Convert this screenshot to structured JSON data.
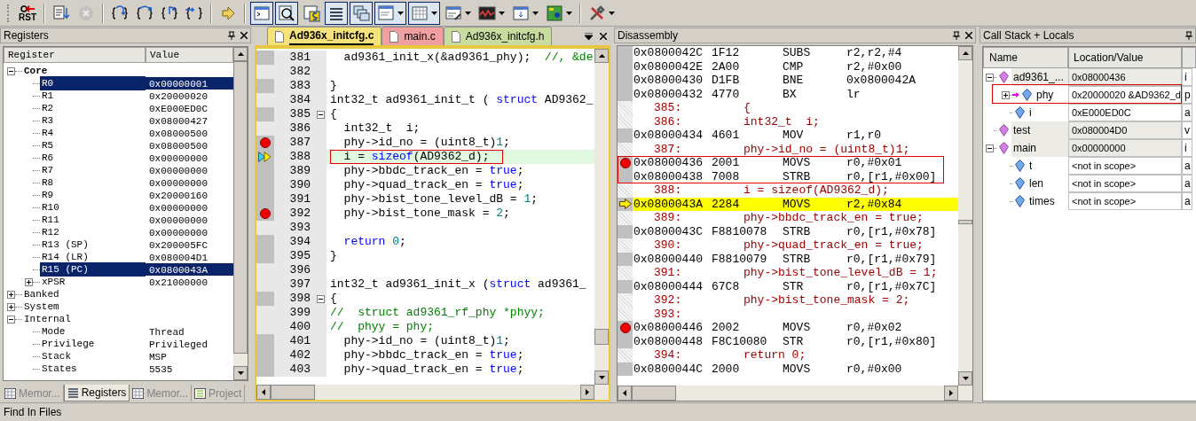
{
  "toolbar": {
    "buttons": [
      {
        "kind": "reset",
        "label": "RST",
        "pressed": false,
        "disabled": false,
        "dropdown": false
      },
      {
        "kind": "run",
        "pressed": false,
        "disabled": false,
        "dropdown": false
      },
      {
        "kind": "stop",
        "pressed": false,
        "disabled": true,
        "dropdown": false
      },
      {
        "kind": "step-into",
        "pressed": false,
        "disabled": false,
        "dropdown": false
      },
      {
        "kind": "step-over",
        "pressed": false,
        "disabled": false,
        "dropdown": false
      },
      {
        "kind": "step-out",
        "pressed": false,
        "disabled": false,
        "dropdown": false
      },
      {
        "kind": "run-to-cursor",
        "pressed": false,
        "disabled": false,
        "dropdown": false
      },
      {
        "kind": "show-next",
        "pressed": false,
        "disabled": false,
        "dropdown": false
      },
      {
        "kind": "command",
        "pressed": true,
        "disabled": false,
        "dropdown": false
      },
      {
        "kind": "disassembly",
        "pressed": true,
        "disabled": false,
        "dropdown": false
      },
      {
        "kind": "symbols",
        "pressed": false,
        "disabled": false,
        "dropdown": false
      },
      {
        "kind": "registers",
        "pressed": true,
        "disabled": false,
        "dropdown": false
      },
      {
        "kind": "call-stack",
        "pressed": true,
        "disabled": false,
        "dropdown": false
      },
      {
        "kind": "watch",
        "pressed": true,
        "disabled": false,
        "dropdown": true
      },
      {
        "kind": "memory",
        "pressed": true,
        "disabled": false,
        "dropdown": true
      },
      {
        "kind": "serial",
        "pressed": false,
        "disabled": false,
        "dropdown": true
      },
      {
        "kind": "analysis",
        "pressed": false,
        "disabled": false,
        "dropdown": true
      },
      {
        "kind": "trace",
        "pressed": false,
        "disabled": false,
        "dropdown": true
      },
      {
        "kind": "system-viewer",
        "pressed": false,
        "disabled": false,
        "dropdown": true
      },
      {
        "kind": "tools",
        "pressed": false,
        "disabled": false,
        "dropdown": true
      }
    ]
  },
  "registers": {
    "title": "Registers",
    "columns": [
      "Register",
      "Value"
    ],
    "tree": [
      {
        "name": "Core",
        "bold": true,
        "expanded": true,
        "selected": false,
        "children": [
          {
            "name": "R0",
            "value": "0x00000001",
            "selected": true
          },
          {
            "name": "R1",
            "value": "0x20000020",
            "selected": false
          },
          {
            "name": "R2",
            "value": "0xE000ED0C",
            "selected": false
          },
          {
            "name": "R3",
            "value": "0x08000427",
            "selected": false
          },
          {
            "name": "R4",
            "value": "0x08000500",
            "selected": false
          },
          {
            "name": "R5",
            "value": "0x08000500",
            "selected": false
          },
          {
            "name": "R6",
            "value": "0x00000000",
            "selected": false
          },
          {
            "name": "R7",
            "value": "0x00000000",
            "selected": false
          },
          {
            "name": "R8",
            "value": "0x00000000",
            "selected": false
          },
          {
            "name": "R9",
            "value": "0x20000160",
            "selected": false
          },
          {
            "name": "R10",
            "value": "0x00000000",
            "selected": false
          },
          {
            "name": "R11",
            "value": "0x00000000",
            "selected": false
          },
          {
            "name": "R12",
            "value": "0x00000000",
            "selected": false
          },
          {
            "name": "R13 (SP)",
            "value": "0x200005FC",
            "selected": false
          },
          {
            "name": "R14 (LR)",
            "value": "0x080004D1",
            "selected": false
          },
          {
            "name": "R15 (PC)",
            "value": "0x0800043A",
            "selected": true
          },
          {
            "name": "xPSR",
            "value": "0x21000000",
            "selected": false,
            "expanded": false
          }
        ]
      },
      {
        "name": "Banked",
        "bold": false,
        "expanded": false,
        "selected": false
      },
      {
        "name": "System",
        "bold": false,
        "expanded": false,
        "selected": false
      },
      {
        "name": "Internal",
        "bold": false,
        "expanded": true,
        "selected": false,
        "children": [
          {
            "name": "Mode",
            "value": "Thread",
            "selected": false
          },
          {
            "name": "Privilege",
            "value": "Privileged",
            "selected": false
          },
          {
            "name": "Stack",
            "value": "MSP",
            "selected": false
          },
          {
            "name": "States",
            "value": "5535",
            "selected": false
          }
        ]
      }
    ],
    "tabs": [
      {
        "label": "Memor...",
        "kind": "memory",
        "selected": false
      },
      {
        "label": "Registers",
        "kind": "registers",
        "selected": true
      },
      {
        "label": "Memor...",
        "kind": "memory",
        "selected": false
      },
      {
        "label": "Project",
        "kind": "project",
        "selected": false
      }
    ]
  },
  "editor": {
    "tabs": [
      {
        "label": "Ad936x_initcfg.c",
        "selected": true,
        "color": "#f5e27a"
      },
      {
        "label": "main.c",
        "selected": false,
        "color": "#f0a0a0"
      },
      {
        "label": "Ad936x_initcfg.h",
        "selected": false,
        "color": "#c8dca0"
      }
    ],
    "lines": [
      {
        "number": "381",
        "executable": true,
        "breakpoint": false,
        "current": false,
        "boxed": false,
        "fold_start": false,
        "tokens": [
          {
            "text": "  ad9361_init_x(&ad9361_phy);  ",
            "kind": "plain"
          },
          {
            "text": "//, &de",
            "kind": "comment"
          }
        ]
      },
      {
        "number": "382",
        "executable": false,
        "breakpoint": false,
        "current": false,
        "fold_start": false
      },
      {
        "number": "383",
        "executable": true,
        "breakpoint": false,
        "current": false,
        "boxed": false,
        "fold_start": false,
        "tokens": [
          {
            "text": "}",
            "kind": "plain"
          }
        ]
      },
      {
        "number": "384",
        "executable": false,
        "breakpoint": false,
        "current": false,
        "boxed": false,
        "fold_start": false,
        "tokens": [
          {
            "text": "int32_t ad9361_init_t ( ",
            "kind": "plain"
          },
          {
            "text": "struct",
            "kind": "keyword"
          },
          {
            "text": " AD9362_",
            "kind": "plain"
          }
        ]
      },
      {
        "number": "385",
        "executable": true,
        "breakpoint": false,
        "current": false,
        "boxed": false,
        "fold_start": true,
        "tokens": [
          {
            "text": "{",
            "kind": "plain"
          }
        ]
      },
      {
        "number": "386",
        "executable": false,
        "breakpoint": false,
        "current": false,
        "boxed": false,
        "fold_start": false,
        "tokens": [
          {
            "text": "  int32_t  i;",
            "kind": "plain"
          }
        ]
      },
      {
        "number": "387",
        "executable": true,
        "breakpoint": true,
        "current": false,
        "boxed": false,
        "fold_start": false,
        "tokens": [
          {
            "text": "  phy->id_no = (uint8_t)",
            "kind": "plain"
          },
          {
            "text": "1",
            "kind": "number"
          },
          {
            "text": ";",
            "kind": "plain"
          }
        ]
      },
      {
        "number": "388",
        "executable": true,
        "breakpoint": false,
        "current": true,
        "boxed": true,
        "fold_start": false,
        "tokens": [
          {
            "text": "  i = ",
            "kind": "plain"
          },
          {
            "text": "sizeof",
            "kind": "keyword"
          },
          {
            "text": "(AD9362_d);",
            "kind": "plain"
          }
        ]
      },
      {
        "number": "389",
        "executable": true,
        "breakpoint": false,
        "current": false,
        "boxed": false,
        "fold_start": false,
        "tokens": [
          {
            "text": "  phy->bbdc_track_en = ",
            "kind": "plain"
          },
          {
            "text": "true",
            "kind": "keyword"
          },
          {
            "text": ";",
            "kind": "plain"
          }
        ]
      },
      {
        "number": "390",
        "executable": true,
        "breakpoint": false,
        "current": false,
        "boxed": false,
        "fold_start": false,
        "tokens": [
          {
            "text": "  phy->quad_track_en = ",
            "kind": "plain"
          },
          {
            "text": "true",
            "kind": "keyword"
          },
          {
            "text": ";",
            "kind": "plain"
          }
        ]
      },
      {
        "number": "391",
        "executable": true,
        "breakpoint": false,
        "current": false,
        "boxed": false,
        "fold_start": false,
        "tokens": [
          {
            "text": "  phy->bist_tone_level_dB = ",
            "kind": "plain"
          },
          {
            "text": "1",
            "kind": "number"
          },
          {
            "text": ";",
            "kind": "plain"
          }
        ]
      },
      {
        "number": "392",
        "executable": true,
        "breakpoint": true,
        "current": false,
        "boxed": false,
        "fold_start": false,
        "tokens": [
          {
            "text": "  phy->bist_tone_mask = ",
            "kind": "plain"
          },
          {
            "text": "2",
            "kind": "number"
          },
          {
            "text": ";",
            "kind": "plain"
          }
        ]
      },
      {
        "number": "393",
        "executable": false,
        "breakpoint": false,
        "current": false,
        "fold_start": false
      },
      {
        "number": "394",
        "executable": true,
        "breakpoint": false,
        "current": false,
        "boxed": false,
        "fold_start": false,
        "tokens": [
          {
            "text": "  return",
            "kind": "keyword"
          },
          {
            "text": " 0",
            "kind": "number"
          },
          {
            "text": ";",
            "kind": "plain"
          }
        ]
      },
      {
        "number": "395",
        "executable": true,
        "breakpoint": false,
        "current": false,
        "boxed": false,
        "fold_start": false,
        "tokens": [
          {
            "text": "}",
            "kind": "plain"
          }
        ]
      },
      {
        "number": "396",
        "executable": false,
        "breakpoint": false,
        "current": false,
        "fold_start": false
      },
      {
        "number": "397",
        "executable": false,
        "breakpoint": false,
        "current": false,
        "boxed": false,
        "fold_start": false,
        "tokens": [
          {
            "text": "int32_t ad9361_init_x (",
            "kind": "plain"
          },
          {
            "text": "struct",
            "kind": "keyword"
          },
          {
            "text": " ad9361_",
            "kind": "plain"
          }
        ]
      },
      {
        "number": "398",
        "executable": true,
        "breakpoint": false,
        "current": false,
        "boxed": false,
        "fold_start": true,
        "tokens": [
          {
            "text": "{",
            "kind": "plain"
          }
        ]
      },
      {
        "number": "399",
        "executable": false,
        "breakpoint": false,
        "current": false,
        "boxed": false,
        "fold_start": false,
        "tokens": [
          {
            "text": "//  struct ad9361_rf_phy *phyy;",
            "kind": "comment"
          }
        ]
      },
      {
        "number": "400",
        "executable": false,
        "breakpoint": false,
        "current": false,
        "boxed": false,
        "fold_start": false,
        "tokens": [
          {
            "text": "//  phyy = phy;",
            "kind": "comment"
          }
        ]
      },
      {
        "number": "401",
        "executable": true,
        "breakpoint": false,
        "current": false,
        "boxed": false,
        "fold_start": false,
        "tokens": [
          {
            "text": "  phy->id_no = (uint8_t)",
            "kind": "plain"
          },
          {
            "text": "1",
            "kind": "number"
          },
          {
            "text": ";",
            "kind": "plain"
          }
        ]
      },
      {
        "number": "402",
        "executable": true,
        "breakpoint": false,
        "current": false,
        "boxed": false,
        "fold_start": false,
        "tokens": [
          {
            "text": "  phy->bbdc_track_en = ",
            "kind": "plain"
          },
          {
            "text": "true",
            "kind": "keyword"
          },
          {
            "text": ";",
            "kind": "plain"
          }
        ]
      },
      {
        "number": "403",
        "executable": true,
        "breakpoint": false,
        "current": false,
        "boxed": false,
        "fold_start": false,
        "tokens": [
          {
            "text": "  phy->quad_track_en = ",
            "kind": "plain"
          },
          {
            "text": "true",
            "kind": "keyword"
          },
          {
            "text": ";",
            "kind": "plain"
          }
        ]
      }
    ]
  },
  "disassembly": {
    "title": "Disassembly",
    "rows": [
      {
        "kind": "asm",
        "address": "0x0800042C",
        "opcode": "1F12",
        "mnemonic": "SUBS",
        "operand": "r2,r2,#4",
        "breakpoint": false,
        "current": false,
        "boxed": false
      },
      {
        "kind": "asm",
        "address": "0x0800042E",
        "opcode": "2A00",
        "mnemonic": "CMP",
        "operand": "r2,#0x00",
        "breakpoint": false,
        "current": false,
        "boxed": false
      },
      {
        "kind": "asm",
        "address": "0x08000430",
        "opcode": "D1FB",
        "mnemonic": "BNE",
        "operand": "0x0800042A",
        "breakpoint": false,
        "current": false,
        "boxed": false
      },
      {
        "kind": "asm",
        "address": "0x08000432",
        "opcode": "4770",
        "mnemonic": "BX",
        "operand": "lr",
        "breakpoint": false,
        "current": false,
        "boxed": false
      },
      {
        "kind": "source",
        "line": "385:",
        "text": "{"
      },
      {
        "kind": "source",
        "line": "386:",
        "text": "int32_t  i;"
      },
      {
        "kind": "asm",
        "address": "0x08000434",
        "opcode": "4601",
        "mnemonic": "MOV",
        "operand": "r1,r0",
        "breakpoint": false,
        "current": false,
        "boxed": false
      },
      {
        "kind": "source",
        "line": "387:",
        "text": "phy->id_no = (uint8_t)1;"
      },
      {
        "kind": "asm",
        "address": "0x08000436",
        "opcode": "2001",
        "mnemonic": "MOVS",
        "operand": "r0,#0x01",
        "breakpoint": true,
        "current": false,
        "boxed": true
      },
      {
        "kind": "asm",
        "address": "0x08000438",
        "opcode": "7008",
        "mnemonic": "STRB",
        "operand": "r0,[r1,#0x00]",
        "breakpoint": false,
        "current": false,
        "boxed": true
      },
      {
        "kind": "source",
        "line": "388:",
        "text": "i = sizeof(AD9362_d);"
      },
      {
        "kind": "asm",
        "address": "0x0800043A",
        "opcode": "2284",
        "mnemonic": "MOVS",
        "operand": "r2,#0x84",
        "breakpoint": false,
        "current": true,
        "boxed": false
      },
      {
        "kind": "source",
        "line": "389:",
        "text": "phy->bbdc_track_en = true;"
      },
      {
        "kind": "asm",
        "address": "0x0800043C",
        "opcode": "F8810078",
        "mnemonic": "STRB",
        "operand": "r0,[r1,#0x78]",
        "breakpoint": false,
        "current": false,
        "boxed": false
      },
      {
        "kind": "source",
        "line": "390:",
        "text": "phy->quad_track_en = true;"
      },
      {
        "kind": "asm",
        "address": "0x08000440",
        "opcode": "F8810079",
        "mnemonic": "STRB",
        "operand": "r0,[r1,#0x79]",
        "breakpoint": false,
        "current": false,
        "boxed": false
      },
      {
        "kind": "source",
        "line": "391:",
        "text": "phy->bist_tone_level_dB = 1;"
      },
      {
        "kind": "asm",
        "address": "0x08000444",
        "opcode": "67C8",
        "mnemonic": "STR",
        "operand": "r0,[r1,#0x7C]",
        "breakpoint": false,
        "current": false,
        "boxed": false
      },
      {
        "kind": "source",
        "line": "392:",
        "text": "phy->bist_tone_mask = 2;"
      },
      {
        "kind": "source",
        "line": "393:"
      },
      {
        "kind": "asm",
        "address": "0x08000446",
        "opcode": "2002",
        "mnemonic": "MOVS",
        "operand": "r0,#0x02",
        "breakpoint": true,
        "current": false,
        "boxed": false
      },
      {
        "kind": "asm",
        "address": "0x08000448",
        "opcode": "F8C10080",
        "mnemonic": "STR",
        "operand": "r0,[r1,#0x80]",
        "breakpoint": false,
        "current": false,
        "boxed": false
      },
      {
        "kind": "source",
        "line": "394:",
        "text": "return 0;"
      },
      {
        "kind": "asm",
        "address": "0x0800044C",
        "opcode": "2000",
        "mnemonic": "MOVS",
        "operand": "r0,#0x00",
        "breakpoint": false,
        "current": false,
        "boxed": false
      }
    ]
  },
  "call_stack": {
    "title": "Call Stack + Locals",
    "columns": [
      "Name",
      "Location/Value"
    ],
    "tree": [
      {
        "kind": "function",
        "name": "ad9361_...",
        "value": "0x08000436",
        "column_3": "i",
        "expanded": true,
        "pointer": false,
        "boxed": false,
        "children": [
          {
            "kind": "variable",
            "name": "phy",
            "value": "0x20000020 &AD9362_d",
            "column_3": "p",
            "expanded": false,
            "pointer": true,
            "boxed": true
          },
          {
            "kind": "variable",
            "name": "i",
            "value": "0xE000ED0C",
            "column_3": "a",
            "pointer": false,
            "boxed": false
          }
        ]
      },
      {
        "kind": "function",
        "name": "test",
        "value": "0x080004D0",
        "column_3": "v",
        "pointer": false,
        "boxed": false
      },
      {
        "kind": "function",
        "name": "main",
        "value": "0x00000000",
        "column_3": "i",
        "expanded": true,
        "pointer": false,
        "boxed": false,
        "children": [
          {
            "kind": "variable",
            "name": "t",
            "value": "<not in scope>",
            "column_3": "a",
            "pointer": false,
            "boxed": false
          },
          {
            "kind": "variable",
            "name": "len",
            "value": "<not in scope>",
            "column_3": "a",
            "pointer": false,
            "boxed": false
          },
          {
            "kind": "variable",
            "name": "times",
            "value": "<not in scope>",
            "column_3": "a",
            "pointer": false,
            "boxed": false
          }
        ]
      }
    ]
  },
  "bottom_panel": {
    "title": "Find In Files"
  }
}
